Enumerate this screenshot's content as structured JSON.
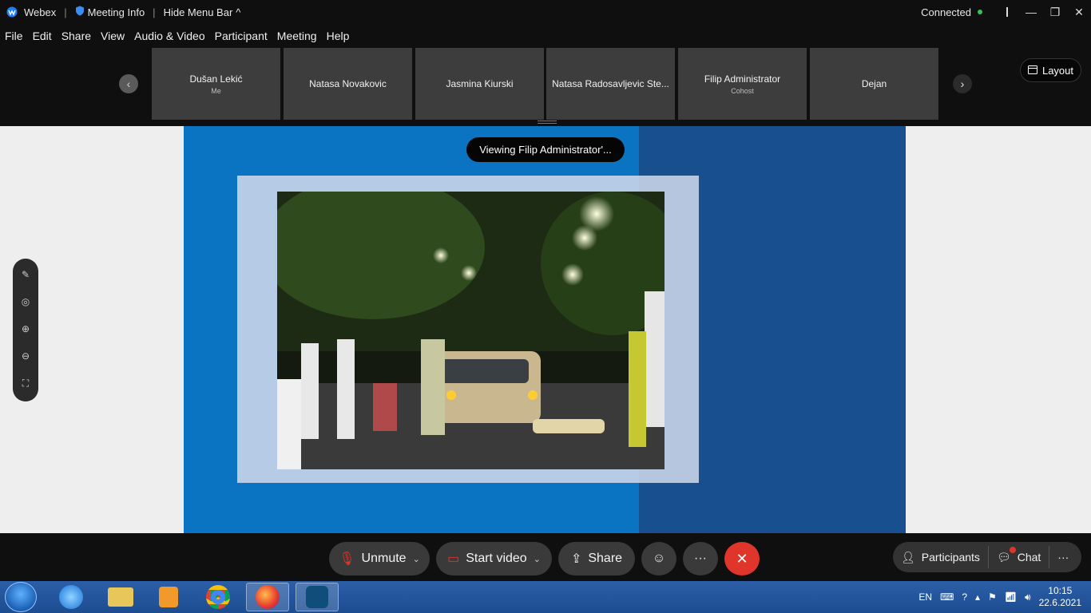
{
  "titlebar": {
    "app_name": "Webex",
    "meeting_info": "Meeting Info",
    "hide_menu": "Hide Menu Bar",
    "status": "Connected"
  },
  "menu": {
    "items": [
      "File",
      "Edit",
      "Share",
      "View",
      "Audio & Video",
      "Participant",
      "Meeting",
      "Help"
    ]
  },
  "participants": [
    {
      "name": "Dušan Lekić",
      "role": "Me"
    },
    {
      "name": "Natasa Novakovic",
      "role": ""
    },
    {
      "name": "Jasmina Kiurski",
      "role": ""
    },
    {
      "name": "Natasa Radosavljevic Ste...",
      "role": ""
    },
    {
      "name": "Filip Administrator",
      "role": "Cohost"
    },
    {
      "name": "Dejan",
      "role": ""
    }
  ],
  "layout_label": "Layout",
  "viewing_toast": "Viewing Filip Administrator'...",
  "controls": {
    "unmute": "Unmute",
    "start_video": "Start video",
    "share": "Share",
    "participants": "Participants",
    "chat": "Chat"
  },
  "taskbar": {
    "lang": "EN",
    "time": "10:15",
    "date": "22.6.2021"
  },
  "colors": {
    "slide_blue": "#0a73c2",
    "slide_dark_blue": "#174f8f",
    "end_red": "#e0352b",
    "connected_green": "#35c45a"
  }
}
